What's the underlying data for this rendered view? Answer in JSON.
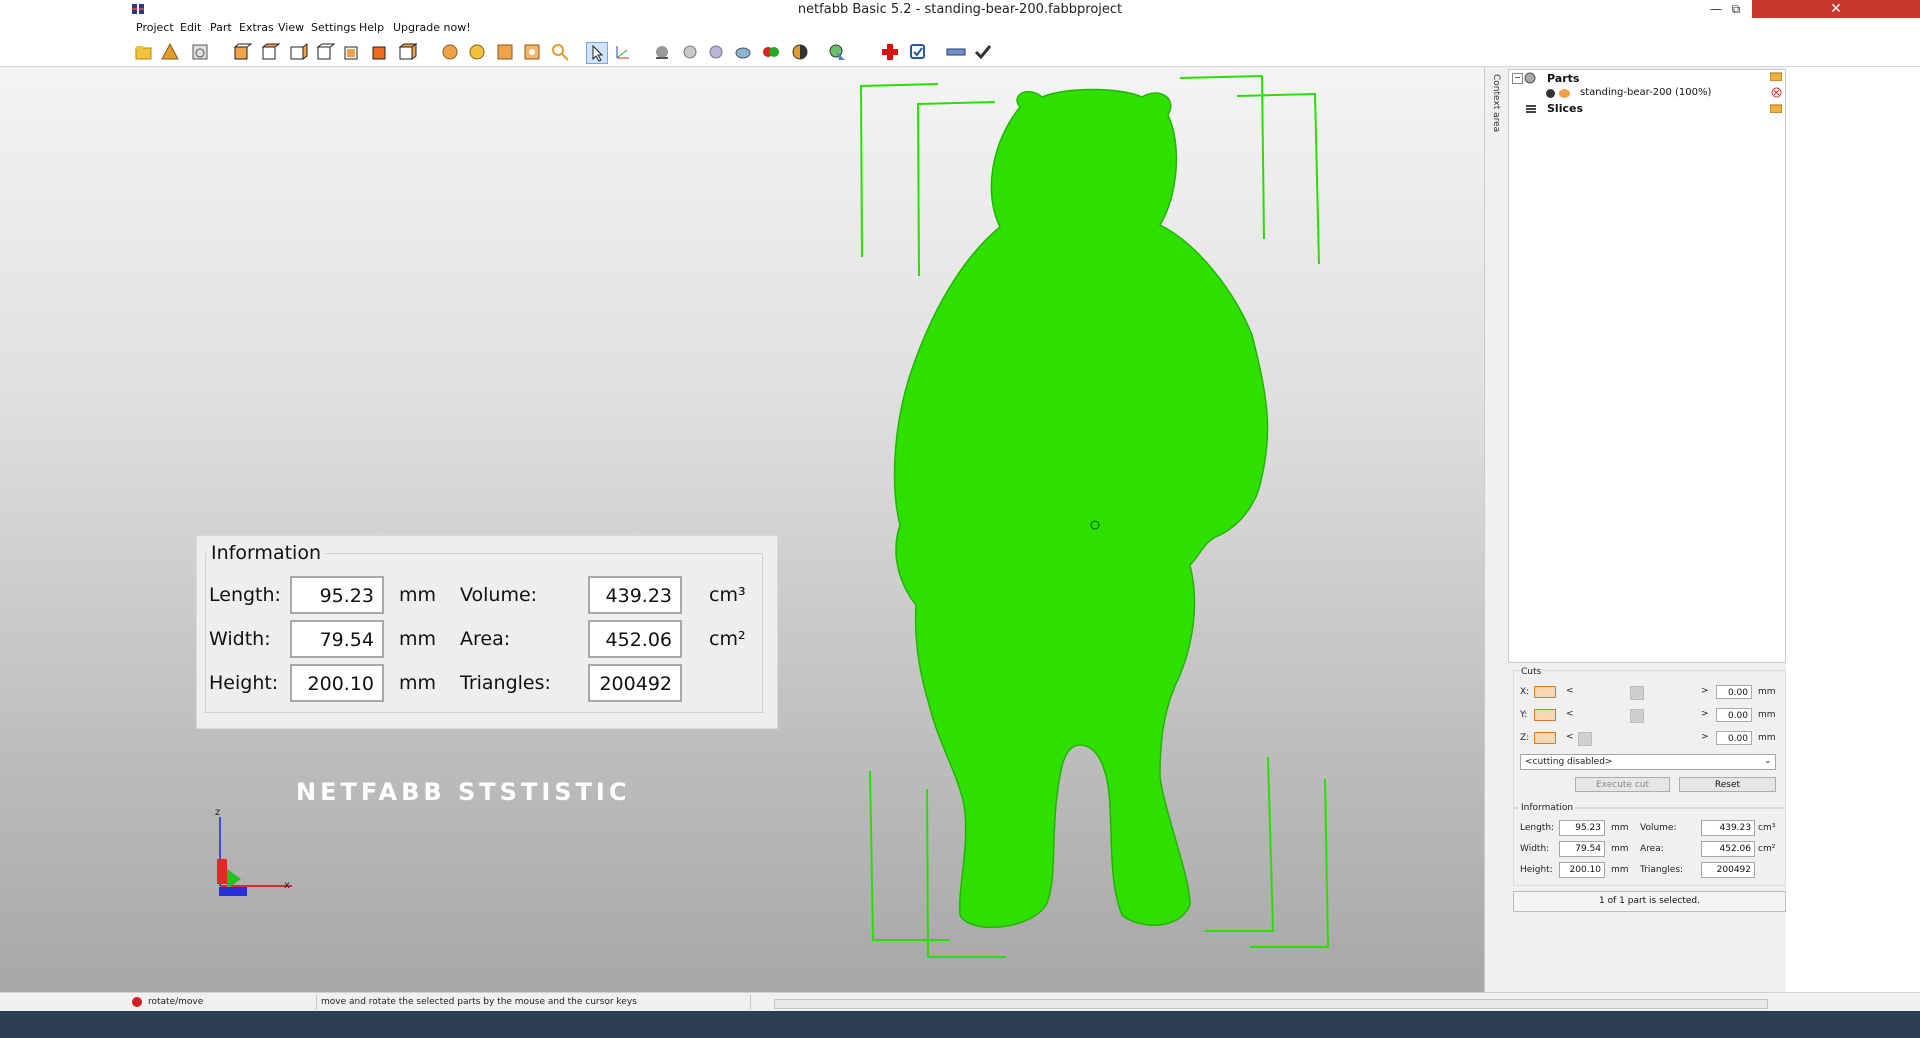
{
  "window": {
    "title": "netfabb Basic 5.2 - standing-bear-200.fabbproject",
    "minimize_icon": "minimize-icon",
    "maximize_icon": "restore-icon",
    "close_icon": "close-icon"
  },
  "menu": [
    "Project",
    "Edit",
    "Part",
    "Extras",
    "View",
    "Settings",
    "Help",
    "Upgrade now!"
  ],
  "toolbar_icons": [
    "open-project-icon",
    "add-part-icon",
    "save-icon",
    "view-front-icon",
    "view-back-icon",
    "view-left-icon",
    "view-right-icon",
    "view-top-icon",
    "view-bottom-icon",
    "view-iso-icon",
    "zoom-all-icon",
    "zoom-selection-icon",
    "zoom-part-icon",
    "zoom-icon",
    "search-icon",
    "select-cursor-icon",
    "move-icon",
    "shading-icon",
    "light-icon",
    "material-icon",
    "render-icon",
    "color-icon",
    "section-icon",
    "measure-icon",
    "repair-icon",
    "flag-icon",
    "ruler-icon",
    "checkmark-icon"
  ],
  "viewport": {
    "info_panel": {
      "title": "Information",
      "length_label": "Length:",
      "length_value": "95.23",
      "length_unit": "mm",
      "width_label": "Width:",
      "width_value": "79.54",
      "width_unit": "mm",
      "height_label": "Height:",
      "height_value": "200.10",
      "height_unit": "mm",
      "volume_label": "Volume:",
      "volume_value": "439.23",
      "volume_unit": "cm³",
      "area_label": "Area:",
      "area_value": "452.06",
      "area_unit": "cm²",
      "triangles_label": "Triangles:",
      "triangles_value": "200492"
    },
    "overlay_title": "NETFABB STSTISTIC",
    "axis_x": "x",
    "axis_z": "z",
    "model_color": "#2ee000"
  },
  "side_tab": "Context area",
  "tree": {
    "parts_label": "Parts",
    "part_name": "standing-bear-200 (100%)",
    "slices_label": "Slices"
  },
  "cuts": {
    "title": "Cuts",
    "x_label": "X:",
    "x_value": "0.00",
    "y_label": "Y:",
    "y_value": "0.00",
    "z_label": "Z:",
    "z_value": "0.00",
    "unit": "mm",
    "mode_select": "<cutting disabled>",
    "execute_label": "Execute cut",
    "reset_label": "Reset"
  },
  "info_small": {
    "title": "Information",
    "length_label": "Length:",
    "length_value": "95.23",
    "length_unit": "mm",
    "width_label": "Width:",
    "width_value": "79.54",
    "width_unit": "mm",
    "height_label": "Height:",
    "height_value": "200.10",
    "height_unit": "mm",
    "volume_label": "Volume:",
    "volume_value": "439.23",
    "volume_unit": "cm³",
    "area_label": "Area:",
    "area_value": "452.06",
    "area_unit": "cm²",
    "triangles_label": "Triangles:",
    "triangles_value": "200492",
    "selected_text": "1 of 1 part is selected."
  },
  "status": {
    "mode": "rotate/move",
    "hint": "move and rotate the selected parts by the mouse and the cursor keys"
  }
}
